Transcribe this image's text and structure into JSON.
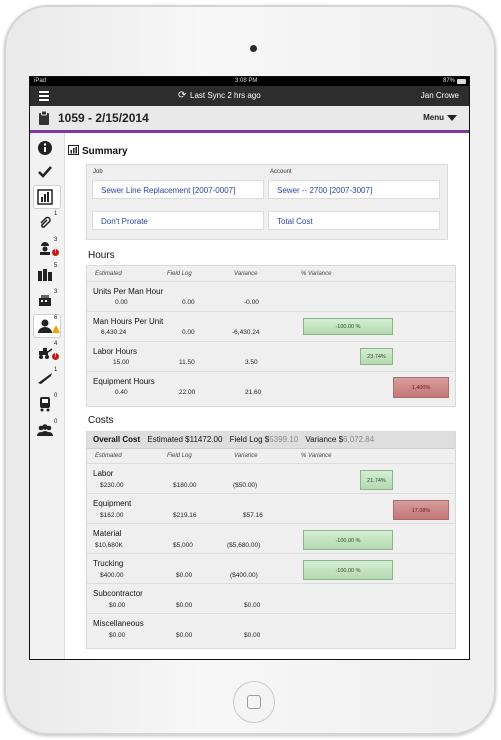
{
  "status_bar": {
    "device": "iPad",
    "time": "3:08 PM",
    "battery": "87%"
  },
  "nav": {
    "sync_text": "Last Sync 2 hrs ago",
    "user_name": "Jan Crowe"
  },
  "title_bar": {
    "title": "1059 - 2/15/2014",
    "menu_label": "Menu"
  },
  "sidebar": {
    "items": [
      {
        "icon": "info-icon",
        "badge": ""
      },
      {
        "icon": "checkmark-icon",
        "badge": ""
      },
      {
        "icon": "chart-icon",
        "badge": "",
        "active": true
      },
      {
        "icon": "paperclip-icon",
        "badge": "1"
      },
      {
        "icon": "worker-icon",
        "badge": "3",
        "alert": "!"
      },
      {
        "icon": "materials-icon",
        "badge": "5"
      },
      {
        "icon": "forms-icon",
        "badge": "3"
      },
      {
        "icon": "person-icon",
        "badge": "6",
        "warning": true
      },
      {
        "icon": "equipment-icon",
        "badge": "4",
        "alert": "!"
      },
      {
        "icon": "tool-icon",
        "badge": "1"
      },
      {
        "icon": "truck-icon",
        "badge": "0"
      },
      {
        "icon": "crew-icon",
        "badge": "0"
      }
    ]
  },
  "summary": {
    "title": "Summary",
    "job_label": "Job",
    "job_value": "Sewer Line Replacement [2007-0007]",
    "account_label": "Account",
    "account_value": "Sewer -- 2700 [2007-3007]",
    "prorate": "Don't Prorate",
    "total_cost": "Total Cost"
  },
  "hours": {
    "title": "Hours",
    "columns": [
      "Estimated",
      "Field Log",
      "Variance",
      "% Variance"
    ],
    "rows": [
      {
        "name": "Units Per Man Hour",
        "estimated": "0.00",
        "field_log": "0.00",
        "variance": "-0.00",
        "pct": "",
        "pct_value": null
      },
      {
        "name": "Man Hours Per Unit",
        "estimated": "6,430.24",
        "field_log": "0.00",
        "variance": "-6,430.24",
        "pct": "-100.00 %",
        "pct_value": -100.0
      },
      {
        "name": "Labor Hours",
        "estimated": "15.00",
        "field_log": "11.50",
        "variance": "3.50",
        "pct": "23.74%",
        "pct_value": 23.74
      },
      {
        "name": "Equipment Hours",
        "estimated": "0.40",
        "field_log": "22.00",
        "variance": "21.60",
        "pct": "1,400%",
        "pct_value": 1400
      }
    ]
  },
  "costs": {
    "title": "Costs",
    "overall_label": "Overall Cost",
    "overall_estimated": "Estimated $11472.00",
    "overall_field_log_label": "Field Log $",
    "overall_field_log_value": "5399.10",
    "overall_variance_label": "Variance $",
    "overall_variance_value": "6,072.84",
    "columns": [
      "Estimated",
      "Field Log",
      "Variance",
      "% Variance"
    ],
    "rows": [
      {
        "name": "Labor",
        "estimated": "$230.00",
        "field_log": "$180.00",
        "variance": "($50.00)",
        "pct": "21.74%",
        "pct_value": 21.74
      },
      {
        "name": "Equipment",
        "estimated": "$162.00",
        "field_log": "$219.16",
        "variance": "$57.16",
        "pct": "17.08%",
        "pct_value": 17.08
      },
      {
        "name": "Material",
        "estimated": "$10,680K",
        "field_log": "$5,000",
        "variance": "($5,680.00)",
        "pct": "-100.00 %",
        "pct_value": -100.0
      },
      {
        "name": "Trucking",
        "estimated": "$400.00",
        "field_log": "$0.00",
        "variance": "($400.00)",
        "pct": "-100.00 %",
        "pct_value": -100.0
      },
      {
        "name": "Subcontractor",
        "estimated": "$0.00",
        "field_log": "$0.00",
        "variance": "$0.00",
        "pct": "",
        "pct_value": null
      },
      {
        "name": "Miscellaneous",
        "estimated": "$0.00",
        "field_log": "$0.00",
        "variance": "$0.00",
        "pct": "",
        "pct_value": null
      }
    ]
  },
  "colors": {
    "accent": "#7b3aa0",
    "link": "#2a45a5",
    "bar_positive": "#b4d9b1",
    "bar_negative": "#c27878",
    "nav": "#2d2d2d"
  }
}
